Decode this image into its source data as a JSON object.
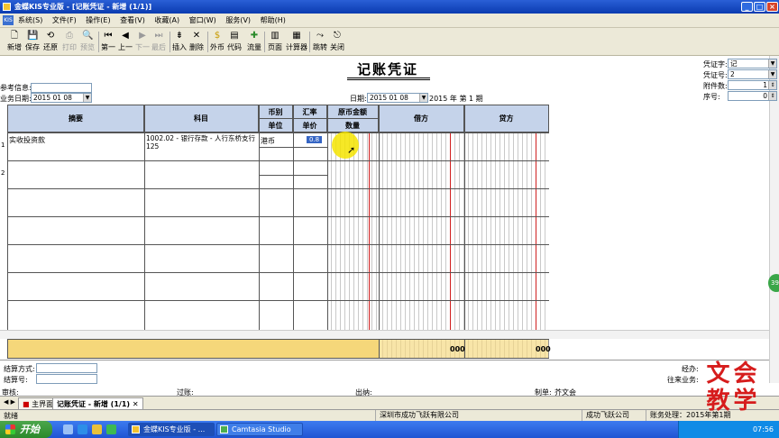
{
  "window": {
    "title": "金蝶KIS专业版 - [记账凭证 - 新增 (1/1)]"
  },
  "menu": [
    "系统(S)",
    "文件(F)",
    "操作(E)",
    "查看(V)",
    "收藏(A)",
    "窗口(W)",
    "服务(V)",
    "帮助(H)"
  ],
  "toolbar": {
    "new": "新增",
    "save": "保存",
    "restore": "还原",
    "print": "打印",
    "preview": "预览",
    "first": "第一",
    "prev": "上一",
    "next": "下一",
    "last": "最后",
    "insert": "插入",
    "delete": "删除",
    "currency": "外币",
    "code": "代码",
    "flow": "流量",
    "page": "页面",
    "calc": "计算器",
    "jump": "跳转",
    "close": "关闭"
  },
  "voucher": {
    "title": "记账凭证",
    "ref_label": "参考信息:",
    "ref_value": "",
    "biz_date_label": "业务日期:",
    "biz_date_value": "2015 01 08",
    "date_label": "日期:",
    "date_value": "2015 01 08",
    "period_text": "2015 年 第 1 期",
    "voucher_word_label": "凭证字:",
    "voucher_word_value": "记",
    "voucher_no_label": "凭证号:",
    "voucher_no_value": "2",
    "attach_label": "附件数:",
    "attach_value": "1",
    "seq_label": "序号:",
    "seq_value": "0"
  },
  "grid": {
    "headers": {
      "summary": "摘要",
      "account": "科目",
      "currency_top": "币别",
      "currency_bottom": "单位",
      "rate_top": "汇率",
      "rate_bottom": "单价",
      "orig_top": "原币金额",
      "orig_bottom": "数量",
      "debit": "借方",
      "credit": "贷方"
    },
    "rows": [
      {
        "num": "1",
        "summary": "实收投资款",
        "account": "1002.02 - 银行存款 - 人行东桥支行125",
        "currency": "港币",
        "rate": "0.8"
      },
      {
        "num": "2",
        "summary": "",
        "account": "",
        "currency": "",
        "rate": ""
      }
    ],
    "totals": {
      "debit": "000",
      "credit": "000"
    }
  },
  "footer": {
    "settle_method_label": "结算方式:",
    "settle_no_label": "结算号:",
    "handler_label": "经办:",
    "contact_label": "往来业务:",
    "audit_label": "审核:",
    "post_label": "过账:",
    "cashier_label": "出纳:",
    "maker_label": "制单:",
    "maker_value": "芥文会"
  },
  "tabs": {
    "home": "主界面",
    "voucher": "记账凭证 - 新增 (1/1)"
  },
  "statusbar": {
    "ready": "就绪",
    "company": "深圳市成功飞跃有限公司",
    "company_short": "成功飞跃公司",
    "period": "账务处理：2015年第1期"
  },
  "taskbar": {
    "start": "开始",
    "task1": "金蝶KIS专业版 - ...",
    "task2": "Camtasia Studio",
    "clock": "07:56"
  },
  "watermark": {
    "line1": "文会",
    "line2": "教学"
  },
  "badge": "39"
}
